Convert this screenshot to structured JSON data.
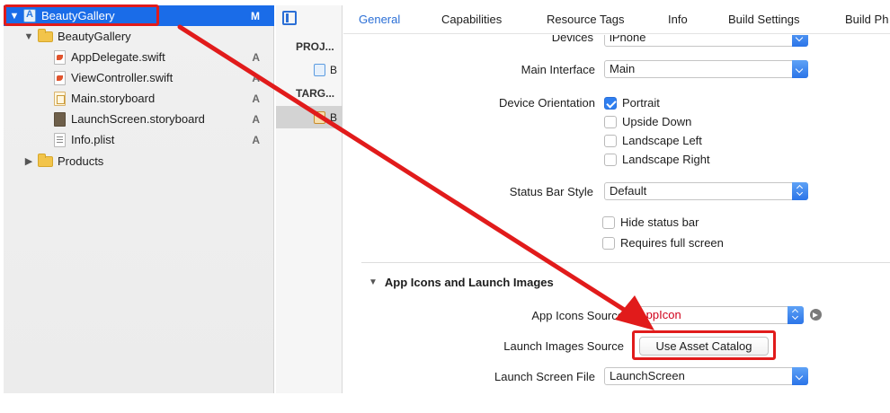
{
  "navigator": {
    "items": [
      {
        "label": "BeautyGallery",
        "badge": "M"
      },
      {
        "label": "BeautyGallery",
        "badge": ""
      },
      {
        "label": "AppDelegate.swift",
        "badge": "A"
      },
      {
        "label": "ViewController.swift",
        "badge": "A"
      },
      {
        "label": "Main.storyboard",
        "badge": "A"
      },
      {
        "label": "LaunchScreen.storyboard",
        "badge": "A"
      },
      {
        "label": "Info.plist",
        "badge": "A"
      },
      {
        "label": "Products",
        "badge": ""
      }
    ]
  },
  "middle": {
    "project_header": "PROJ...",
    "project_item": "B",
    "targets_header": "TARG...",
    "target_item": "B"
  },
  "tabs": [
    {
      "label": "General"
    },
    {
      "label": "Capabilities"
    },
    {
      "label": "Resource Tags"
    },
    {
      "label": "Info"
    },
    {
      "label": "Build Settings"
    },
    {
      "label": "Build Ph"
    }
  ],
  "deployment": {
    "devices_label": "Devices",
    "devices_value": "iPhone",
    "main_interface_label": "Main Interface",
    "main_interface_value": "Main",
    "orientation_label": "Device Orientation",
    "orientations": [
      {
        "label": "Portrait",
        "checked": true
      },
      {
        "label": "Upside Down",
        "checked": false
      },
      {
        "label": "Landscape Left",
        "checked": false
      },
      {
        "label": "Landscape Right",
        "checked": false
      }
    ],
    "status_bar_label": "Status Bar Style",
    "status_bar_value": "Default",
    "hide_status_bar": "Hide status bar",
    "requires_full_screen": "Requires full screen"
  },
  "app_icons": {
    "section_title": "App Icons and Launch Images",
    "icons_source_label": "App Icons Source",
    "icons_source_value": "AppIcon",
    "launch_images_label": "Launch Images Source",
    "launch_images_button": "Use Asset Catalog",
    "launch_screen_label": "Launch Screen File",
    "launch_screen_value": "LaunchScreen"
  },
  "colors": {
    "accent": "#2b6fd6",
    "selection": "#1a6ce8",
    "annotation": "#e11b1b",
    "error_text": "#d0021b"
  }
}
